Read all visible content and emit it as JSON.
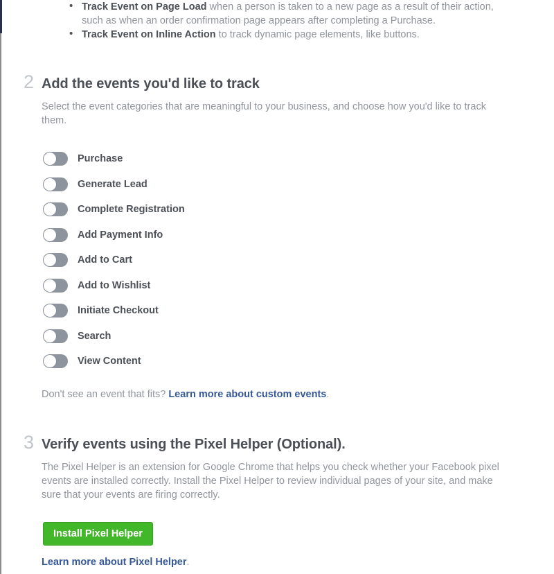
{
  "intro": {
    "bullets": [
      {
        "lead": "Track Event on Page Load",
        "rest": " when a person is taken to a new page as a result of their action, such as when an order confirmation page appears after completing a Purchase."
      },
      {
        "lead": "Track Event on Inline Action",
        "rest": " to track dynamic page elements, like buttons."
      }
    ]
  },
  "section2": {
    "number": "2",
    "title": "Add the events you'd like to track",
    "description": "Select the event categories that are meaningful to your business, and choose how you'd like to track them.",
    "events": [
      {
        "label": "Purchase",
        "enabled": false
      },
      {
        "label": "Generate Lead",
        "enabled": false
      },
      {
        "label": "Complete Registration",
        "enabled": false
      },
      {
        "label": "Add Payment Info",
        "enabled": false
      },
      {
        "label": "Add to Cart",
        "enabled": false
      },
      {
        "label": "Add to Wishlist",
        "enabled": false
      },
      {
        "label": "Initiate Checkout",
        "enabled": false
      },
      {
        "label": "Search",
        "enabled": false
      },
      {
        "label": "View Content",
        "enabled": false
      }
    ],
    "custom_note_prefix": "Don't see an event that fits? ",
    "custom_note_link": "Learn more about custom events",
    "custom_note_suffix": "."
  },
  "section3": {
    "number": "3",
    "title": "Verify events using the Pixel Helper (Optional).",
    "description": "The Pixel Helper is an extension for Google Chrome that helps you check whether your Facebook pixel events are installed correctly. Install the Pixel Helper to review individual pages of your site, and make sure that your events are firing correctly.",
    "install_button": "Install Pixel Helper",
    "learn_more_link": "Learn more about Pixel Helper",
    "learn_more_suffix": "."
  },
  "colors": {
    "link_blue": "#365899",
    "button_green": "#42b72a",
    "toggle_off": "#8d949e",
    "heading_gray": "#4b4f56",
    "body_gray": "#90949c",
    "numeral_gray": "#c3c7cc"
  }
}
